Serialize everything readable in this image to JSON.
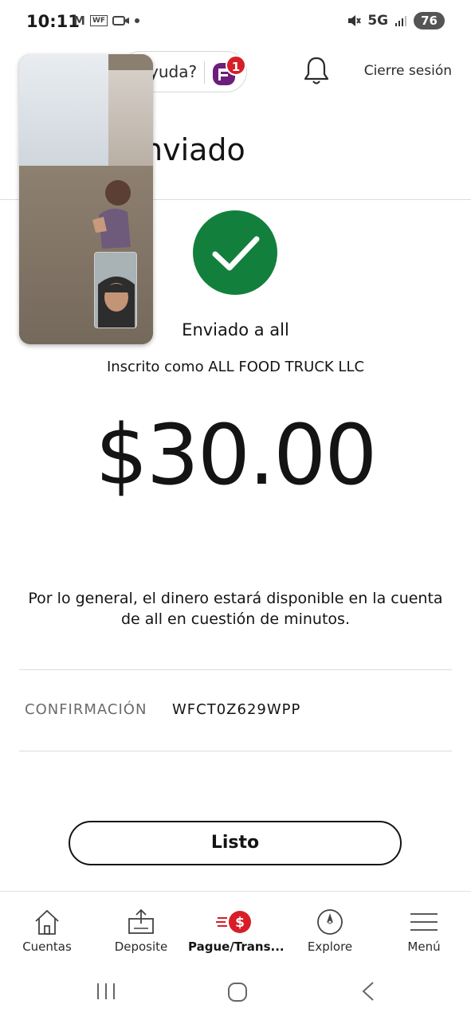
{
  "status_bar": {
    "time": "10:11",
    "network": "5G",
    "battery": "76"
  },
  "header": {
    "help_text": "yuda?",
    "notification_count": "1",
    "logout_label": "Cierre sesión"
  },
  "page": {
    "title": "nviado",
    "sent_to": "Enviado a all",
    "enrolled_as": "Inscrito como ALL FOOD TRUCK LLC",
    "amount": "$30.00",
    "note": "Por lo general, el dinero estará disponible en la cuenta de all en cuestión de minutos.",
    "confirmation_label": "CONFIRMACIÓN",
    "confirmation_value": "WFCT0Z629WPP",
    "done_label": "Listo"
  },
  "bottom_nav": {
    "items": [
      {
        "label": "Cuentas",
        "icon": "home-icon"
      },
      {
        "label": "Deposite",
        "icon": "deposit-icon"
      },
      {
        "label": "Pague/Trans...",
        "icon": "pay-transfer-icon",
        "active": true
      },
      {
        "label": "Explore",
        "icon": "compass-icon"
      },
      {
        "label": "Menú",
        "icon": "hamburger-icon"
      }
    ]
  },
  "colors": {
    "success_green": "#12803c",
    "accent_red": "#d71e28",
    "brand_purple": "#6b1f7a"
  }
}
